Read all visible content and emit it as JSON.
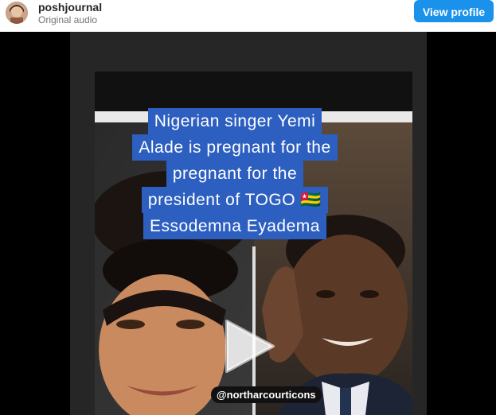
{
  "header": {
    "account_name": "poshjournal",
    "audio_label": "Original audio",
    "view_profile_label": "View profile",
    "view_profile_color": "#1a91ea"
  },
  "video": {
    "caption_lines": [
      "Nigerian singer Yemi",
      "Alade is pregnant for the",
      "pregnant for the",
      "president of TOGO 🇹🇬",
      "Essodemna Eyadema"
    ],
    "caption_bg_color": "#2d5fc1",
    "watermark": "@northarcourticons",
    "play_icon": "play-icon"
  }
}
